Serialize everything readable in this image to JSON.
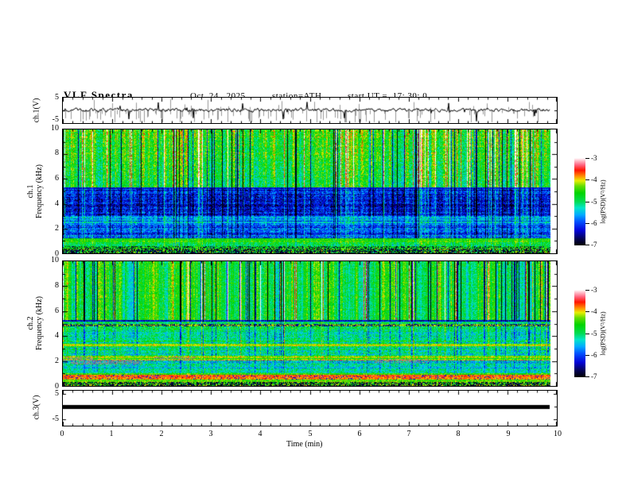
{
  "header": {
    "title": "VLF Spectra",
    "date": "Oct. 24 , 2025",
    "station": "station=ATH",
    "start_ut": "start UT =  17: 30: 0"
  },
  "x_axis": {
    "label": "Time (min)",
    "min": 0,
    "max": 10,
    "ticks": [
      "0",
      "1",
      "2",
      "3",
      "4",
      "5",
      "6",
      "7",
      "8",
      "9",
      "10"
    ]
  },
  "panels": {
    "wave1": {
      "ylabel": "ch.1(V)",
      "yticks": [
        "5",
        "-5"
      ],
      "ylim": [
        -5,
        5
      ]
    },
    "spec1": {
      "ylabel_line1": "ch.1",
      "ylabel_line2": "Frequency (kHz)",
      "yticks": [
        "10",
        "8",
        "6",
        "4",
        "2",
        "0"
      ],
      "ylim": [
        0,
        10
      ]
    },
    "spec2": {
      "ylabel_line1": "ch.2",
      "ylabel_line2": "Frequency (kHz)",
      "yticks": [
        "10",
        "8",
        "6",
        "4",
        "2",
        "0"
      ],
      "ylim": [
        0,
        10
      ]
    },
    "wave3": {
      "ylabel": "ch.3(V)",
      "yticks": [
        "5",
        "-5"
      ],
      "ylim": [
        -5,
        5
      ]
    }
  },
  "colorbar": {
    "label": "log(PSD)(V²/Hz)",
    "ticks": [
      "-3",
      "-4",
      "-5",
      "-6",
      "-7"
    ],
    "min": -7,
    "max": -3,
    "stops": [
      [
        0.0,
        "#000000"
      ],
      [
        0.07,
        "#03024d"
      ],
      [
        0.17,
        "#0202d8"
      ],
      [
        0.27,
        "#0150ff"
      ],
      [
        0.35,
        "#00aaff"
      ],
      [
        0.43,
        "#00e6c8"
      ],
      [
        0.5,
        "#00dc55"
      ],
      [
        0.6,
        "#00d400"
      ],
      [
        0.68,
        "#66dd00"
      ],
      [
        0.74,
        "#e8ee00"
      ],
      [
        0.79,
        "#ff9100"
      ],
      [
        0.86,
        "#ff1500"
      ],
      [
        0.92,
        "#ff637f"
      ],
      [
        0.97,
        "#ffc0cb"
      ],
      [
        1.0,
        "#ffffff"
      ]
    ]
  },
  "chart_data": [
    {
      "id": "ch1_waveform",
      "type": "line",
      "ylabel": "ch.1(V)",
      "xlim": [
        0,
        10
      ],
      "ylim": [
        -5,
        5
      ],
      "x_unit": "min",
      "baseline_v": 0.3,
      "noise_amp_v": 1.2,
      "spike_prob": 0.04,
      "gray_spike_prob": 0.16,
      "data_end_min": 9.87,
      "seed": 11,
      "description": "noisy broadband signal near 0 V with impulsive spikes toward -5 and +5 V"
    },
    {
      "id": "ch1_spectrogram",
      "type": "heatmap",
      "ylabel": "ch.1 Frequency (kHz)",
      "xlim": [
        0,
        10
      ],
      "ylim": [
        0,
        10
      ],
      "zlim": [
        -7,
        -3
      ],
      "zlabel": "log(PSD)(V²/Hz)",
      "data_end_min": 9.87,
      "seed": 23,
      "dark_streak_prob": 0.07,
      "bright_streak_prob": 0.055,
      "bands": [
        {
          "f0": 5.35,
          "f1": 10.0,
          "base": -4.85,
          "var": 0.45,
          "row": 0.12,
          "streak": 0.85,
          "grad": 0.35
        },
        {
          "f0": 5.18,
          "f1": 5.35,
          "base": -6.3,
          "var": 0.3,
          "row": 0.1,
          "streak": 0.2
        },
        {
          "f0": 3.0,
          "f1": 5.18,
          "base": -6.25,
          "var": 0.5,
          "row": 0.3,
          "streak": 0.45
        },
        {
          "f0": 2.35,
          "f1": 3.0,
          "base": -5.65,
          "var": 0.45,
          "row": 0.45,
          "streak": 0.3
        },
        {
          "f0": 1.2,
          "f1": 2.35,
          "base": -5.9,
          "var": 0.5,
          "row": 0.35,
          "streak": 0.3
        },
        {
          "f0": 0.92,
          "f1": 1.2,
          "base": -4.6,
          "var": 0.3,
          "row": 0.2,
          "streak": 0.15
        },
        {
          "f0": 0.55,
          "f1": 0.92,
          "base": -4.8,
          "var": 0.5,
          "row": 0.45,
          "streak": 0.2
        },
        {
          "f0": 0.3,
          "f1": 0.55,
          "base": -4.6,
          "var": 0.4,
          "row": 0.3,
          "streak": 0.1,
          "dash": 0.35,
          "dash_val": -7
        },
        {
          "f0": 0.0,
          "f1": 0.3,
          "base": -4.5,
          "var": 0.6,
          "row": 0.3,
          "streak": 0.1,
          "dash": 0.55,
          "dash_val": -7
        }
      ],
      "gray_patches": []
    },
    {
      "id": "ch2_spectrogram",
      "type": "heatmap",
      "ylabel": "ch.2 Frequency (kHz)",
      "xlim": [
        0,
        10
      ],
      "ylim": [
        0,
        10
      ],
      "zlim": [
        -7,
        -3
      ],
      "zlabel": "log(PSD)(V²/Hz)",
      "data_end_min": 9.87,
      "seed": 37,
      "dark_streak_prob": 0.1,
      "bright_streak_prob": 0.04,
      "bands": [
        {
          "f0": 5.3,
          "f1": 10.0,
          "base": -4.75,
          "var": 0.35,
          "row": 0.1,
          "streak": 0.9
        },
        {
          "f0": 5.14,
          "f1": 5.3,
          "base": -6.4,
          "var": 0.3,
          "row": 0.1,
          "streak": 0.2
        },
        {
          "f0": 4.95,
          "f1": 5.14,
          "base": -4.9,
          "var": 0.4,
          "row": 0.2,
          "streak": 0.3
        },
        {
          "f0": 4.78,
          "f1": 4.95,
          "base": -4.3,
          "var": 0.3,
          "row": 0.2,
          "streak": 0.1,
          "dash": 0.45,
          "dash_val": -6.8
        },
        {
          "f0": 3.35,
          "f1": 4.78,
          "base": -5.05,
          "var": 0.45,
          "row": 0.35,
          "streak": 0.35
        },
        {
          "f0": 3.18,
          "f1": 3.35,
          "base": -4.25,
          "var": 0.3,
          "row": 0.2,
          "streak": 0.1
        },
        {
          "f0": 2.4,
          "f1": 3.18,
          "base": -5.15,
          "var": 0.5,
          "row": 0.35,
          "streak": 0.3
        },
        {
          "f0": 2.05,
          "f1": 2.4,
          "base": -4.35,
          "var": 0.4,
          "row": 0.3,
          "streak": 0.15
        },
        {
          "f0": 1.5,
          "f1": 2.05,
          "base": -5.35,
          "var": 0.5,
          "row": 0.4,
          "streak": 0.2
        },
        {
          "f0": 1.02,
          "f1": 1.5,
          "base": -5.2,
          "var": 0.45,
          "row": 0.35,
          "streak": 0.2
        },
        {
          "f0": 0.88,
          "f1": 1.02,
          "base": -4.4,
          "var": 0.3,
          "row": 0.2,
          "streak": 0.1
        },
        {
          "f0": 0.52,
          "f1": 0.88,
          "base": -3.75,
          "var": 0.25,
          "row": 0.25,
          "streak": 0.05,
          "dash": 0.12,
          "dash_val": -6.5
        },
        {
          "f0": 0.34,
          "f1": 0.52,
          "base": -4.35,
          "var": 0.3,
          "row": 0.2,
          "streak": 0.05
        },
        {
          "f0": 0.0,
          "f1": 0.34,
          "base": -4.4,
          "var": 0.5,
          "row": 0.2,
          "streak": 0.05,
          "dash": 0.5,
          "dash_val": -7
        }
      ],
      "gray_patches": [
        {
          "f0": 1.75,
          "f1": 2.1,
          "t0": 0.15,
          "t1": 1.6,
          "p": 0.55
        },
        {
          "f0": 2.1,
          "f1": 2.33,
          "t0": 0.0,
          "t1": 0.6,
          "p": 0.5
        },
        {
          "f0": 2.1,
          "f1": 2.33,
          "t0": 1.85,
          "t1": 2.7,
          "p": 0.45
        },
        {
          "f0": 1.85,
          "f1": 2.15,
          "t0": 6.3,
          "t1": 7.4,
          "p": 0.5
        }
      ]
    },
    {
      "id": "ch3_waveform",
      "type": "line",
      "ylabel": "ch.3(V)",
      "xlim": [
        0,
        10
      ],
      "ylim": [
        -5,
        5
      ],
      "value_v": 0,
      "data_end_min": 9.85,
      "description": "constant 0 V thick flat line (no signal)"
    }
  ]
}
